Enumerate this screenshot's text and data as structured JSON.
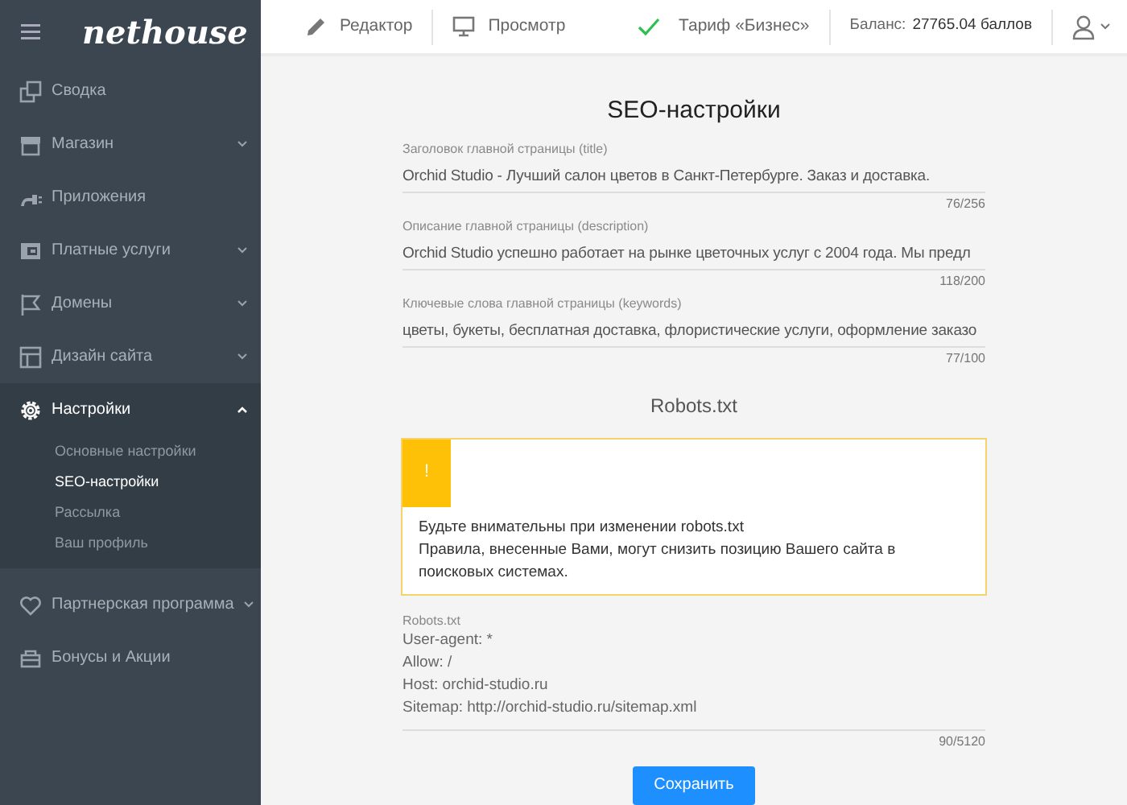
{
  "sidebar": {
    "logo": "nethouse",
    "items": [
      {
        "label": "Сводка",
        "selected": false
      },
      {
        "label": "Магазин",
        "selected": false,
        "expanded": false
      },
      {
        "label": "Приложения",
        "selected": false
      },
      {
        "label": "Платные услуги",
        "selected": false,
        "expanded": false
      },
      {
        "label": "Домены",
        "selected": false,
        "expanded": false
      },
      {
        "label": "Дизайн сайта",
        "selected": false,
        "expanded": false
      },
      {
        "label": "Настройки",
        "selected": true,
        "expanded": true,
        "children": [
          {
            "label": "Основные настройки",
            "selected": false
          },
          {
            "label": "SEO-настройки",
            "selected": true
          },
          {
            "label": "Рассылка",
            "selected": false
          },
          {
            "label": "Ваш профиль",
            "selected": false
          }
        ]
      },
      {
        "label": "Партнерская программа",
        "selected": false,
        "expanded": false
      },
      {
        "label": "Бонусы и Акции",
        "selected": false
      }
    ]
  },
  "topbar": {
    "editor": "Редактор",
    "preview": "Просмотр",
    "tariff": "Тариф «Бизнес»",
    "balance_label": "Баланс:",
    "balance_value": "27765.04 баллов"
  },
  "page": {
    "title": "SEO-настройки",
    "fields": [
      {
        "label": "Заголовок главной страницы (title)",
        "value": "Orchid Studio - Лучший салон цветов в Санкт-Петербурге.  Заказ и доставка.",
        "counter": "76/256"
      },
      {
        "label": "Описание главной страницы (description)",
        "value": "Orchid Studio успешно работает на рынке цветочных услуг с 2004 года. Мы предл",
        "counter": "118/200"
      },
      {
        "label": "Ключевые слова главной страницы (keywords)",
        "value": "цветы, букеты, бесплатная доставка, флористические услуги, оформление заказо",
        "counter": "77/100"
      }
    ],
    "robots_title": "Robots.txt",
    "warning": {
      "icon": "!",
      "lines": [
        "Будьте внимательны при изменении robots.txt",
        "Правила, внесенные Вами, могут снизить позицию Вашего сайта в поисковых системах."
      ]
    },
    "robots": {
      "label": "Robots.txt",
      "lines": [
        "User-agent: *",
        "Allow: /",
        "Host: orchid-studio.ru",
        "Sitemap: http://orchid-studio.ru/sitemap.xml"
      ],
      "counter": "90/5120"
    },
    "save": "Сохранить"
  }
}
